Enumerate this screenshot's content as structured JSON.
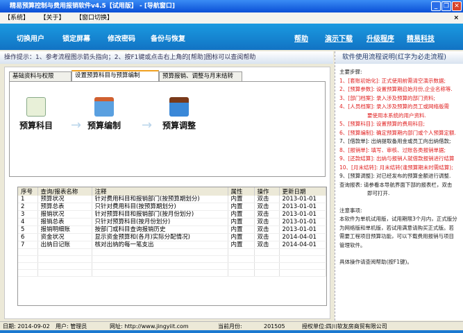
{
  "window": {
    "title": "精易预算控制与费用报销软件v4.5【试用版】 - [导航窗口]",
    "close_child": "×"
  },
  "menu": [
    "【系统】",
    "【关于】",
    "【窗口切换】"
  ],
  "toolbar": {
    "left": [
      "切换用户",
      "锁定屏幕",
      "修改密码",
      "备份与恢复"
    ],
    "right": [
      "帮助",
      "演示下载",
      "升级程序",
      "精易科技"
    ]
  },
  "hint": "操作提示：1、参考流程图示箭头指向；2、按F1键或点击右上角的[帮助]图标可以查阅帮助",
  "tabs": [
    "基础资料与权限",
    "设置预算科目与预算编制",
    "预算报销、调整与月末结转"
  ],
  "flow": [
    "预算科目",
    "预算编制",
    "预算调整"
  ],
  "flow_arrow": "→",
  "table": {
    "headers": [
      "序号",
      "查询/报表名称",
      "注释",
      "属性",
      "操作",
      "更新日期"
    ],
    "rows": [
      [
        "1",
        "预算状况",
        "针对费用科目和报销部门(按预算期划分)",
        "内置",
        "双击",
        "2013-01-01"
      ],
      [
        "2",
        "预算总表",
        "只针对费用科目(按预算期划分)",
        "内置",
        "双击",
        "2013-01-01"
      ],
      [
        "3",
        "报销状况",
        "针对预算科目和报销部门(按月份划分)",
        "内置",
        "双击",
        "2013-01-01"
      ],
      [
        "4",
        "报销总表",
        "只针对预算科目(按月份划分)",
        "内置",
        "双击",
        "2013-01-01"
      ],
      [
        "5",
        "报销明细账",
        "按部门或科目查询报销历史",
        "内置",
        "双击",
        "2013-01-01"
      ],
      [
        "6",
        "资金状况",
        "显示资金预算和(各月)实际分配情况)",
        "内置",
        "双击",
        "2014-04-01"
      ],
      [
        "7",
        "出纳日记账",
        "核对出纳的每一笔支出",
        "内置",
        "双击",
        "2014-04-01"
      ]
    ]
  },
  "right": {
    "title": "软件使用流程说明(红字为必走流程)",
    "steps_label": "主要步骤:",
    "steps": [
      {
        "t": "1、[套账初始化]: 正式使用前需清空演示数据;",
        "red": true
      },
      {
        "t": "2、[预算参数]: 设置预算期启始月份,企业名称等.",
        "red": true
      },
      {
        "t": "3、[部门档案]: 录入涉及预算的部门资料;",
        "red": true
      },
      {
        "t": "4、[人员档案]: 录入涉及预算的员工或网络版需",
        "red": true
      },
      {
        "t": "要使用本系统的用户资料.",
        "red": true,
        "ind": true
      },
      {
        "t": "5、[预算科目]: 设置预算的费用科目;",
        "red": true
      },
      {
        "t": "6、[预算编制]: 确定预算期内部门或个人预算定额.",
        "red": true
      },
      {
        "t": "7、[借款单]: 出纳提取备用金或员工向出纳借款;",
        "red": false
      },
      {
        "t": "8、[报销单]: 填写、审核、过账各类报销单据;",
        "red": true
      },
      {
        "t": "9、[还款结算]: 出纳与报销人就借款报销进行结算",
        "red": true
      },
      {
        "t": "10、[月末结转]: 月末结转(逢预算期末时需结算);",
        "red": true
      },
      {
        "t": "9、[预算调整]: 对已经发布的预算金额进行调整.",
        "red": false
      },
      {
        "t": "查询报表: 请参看本导航界面下部的报表栏，双击",
        "red": false
      },
      {
        "t": "即可打开.",
        "red": false,
        "ind": true
      }
    ],
    "notes_label": "注意事项:",
    "notes": "本软件为单机试用版，试用期限3个月内，正式版分为网络版和单机版，若试用满意请购买正式版。若需要工程项目预算功能，可以下载费用报销与项目管理软件。",
    "help": "具体操作请查阅帮助(按F1键)。"
  },
  "status": {
    "date": "日期: 2014-09-02",
    "user": "用户: 管理员",
    "url": "网址: http://www.jingyiit.com",
    "month_label": "当前月份:",
    "month": "201505",
    "licensee": "授权单位:四川软友房商贸有限公司"
  }
}
